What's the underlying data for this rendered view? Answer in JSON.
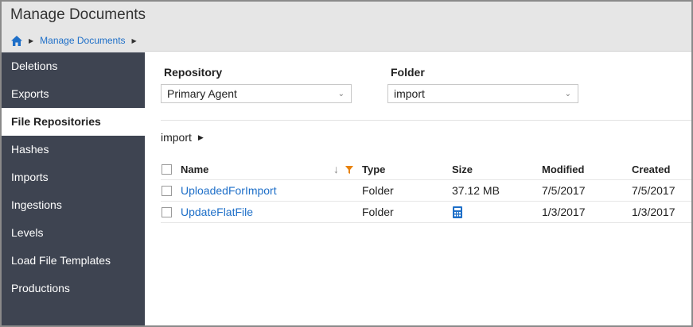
{
  "header": {
    "title": "Manage Documents",
    "breadcrumb": {
      "home_icon": "home-icon",
      "current": "Manage Documents"
    }
  },
  "sidebar": {
    "items": [
      {
        "label": "Deletions",
        "active": false
      },
      {
        "label": "Exports",
        "active": false
      },
      {
        "label": "File Repositories",
        "active": true
      },
      {
        "label": "Hashes",
        "active": false
      },
      {
        "label": "Imports",
        "active": false
      },
      {
        "label": "Ingestions",
        "active": false
      },
      {
        "label": "Levels",
        "active": false
      },
      {
        "label": "Load File Templates",
        "active": false
      },
      {
        "label": "Productions",
        "active": false
      }
    ]
  },
  "filters": {
    "repository": {
      "label": "Repository",
      "value": "Primary Agent"
    },
    "folder": {
      "label": "Folder",
      "value": "import"
    }
  },
  "path": {
    "current": "import"
  },
  "table": {
    "columns": {
      "name": "Name",
      "type": "Type",
      "size": "Size",
      "modified": "Modified",
      "created": "Created"
    },
    "rows": [
      {
        "name": "UploadedForImport",
        "type": "Folder",
        "size": "37.12 MB",
        "modified": "7/5/2017",
        "created": "7/5/2017"
      },
      {
        "name": "UpdateFlatFile",
        "type": "Folder",
        "size": "",
        "size_icon": "calculator-icon",
        "modified": "1/3/2017",
        "created": "1/3/2017"
      }
    ]
  },
  "colors": {
    "header_bg": "#e6e6e6",
    "sidebar_bg": "#3e4451",
    "link": "#1e6fc8",
    "filter_icon": "#e8820c"
  }
}
